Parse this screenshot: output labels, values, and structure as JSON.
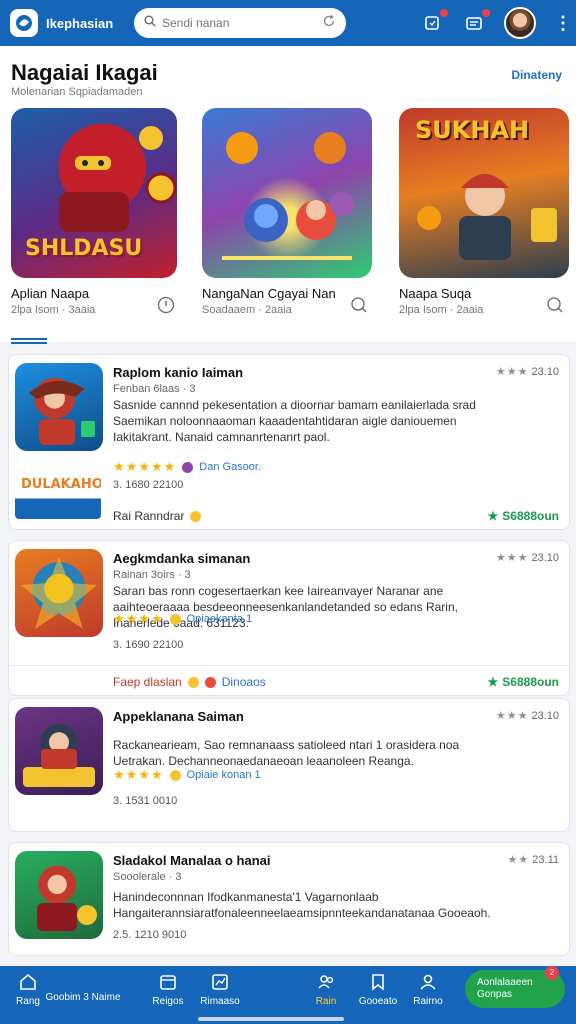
{
  "header": {
    "app_name": "Ikephasian",
    "search": {
      "placeholder": "Sendi nanan",
      "value": ""
    },
    "icons": [
      "logo-icon",
      "search-icon",
      "refresh-icon",
      "notification-icon",
      "inbox-icon",
      "avatar",
      "more-icon"
    ],
    "accent": "#1566b8"
  },
  "section": {
    "title": "Nagaiai Ikagai",
    "subtitle": "Molenarian Sqpiadamaden",
    "link": "Dinateny",
    "featured": [
      {
        "name": "Aplian Naapa",
        "meta": "2lpa Isom · 3aaia",
        "art_text": "SHLDASU",
        "art_colors": [
          "#c21f2a",
          "#1d5fa8",
          "#f4c430"
        ]
      },
      {
        "name": "NangaNan Cgayai Nan",
        "meta": "Soadaaem · 2aaia",
        "art_text": "",
        "art_colors": [
          "#3a7bd5",
          "#8e44ad",
          "#f39c12"
        ]
      },
      {
        "name": "Naapa Suqa",
        "meta": "2lpa Isom · 2aaia",
        "art_text": "SUKHAH",
        "art_colors": [
          "#c0392b",
          "#f39c12",
          "#2c3e50"
        ]
      }
    ]
  },
  "list": [
    {
      "title": "Raplom kanio Iaiman",
      "sub": "Fenban 6laas · 3",
      "desc": "Sasnide cannnd pekesentation a dioornar bamam eanilaierlada srad Saemikan noloonnaaoman kaaadentahtidaran aigle daniouemen Iakitakrant. Nanaid camnanrtenanrt paol.",
      "rating": "★★★★★",
      "tag": "Dan Gasoor.",
      "tag_color": "#8e44ad",
      "stats": "3. 1680 22100",
      "right": "23.10",
      "foot_left": "Rai Ranndrar",
      "foot_right": "S6888oun",
      "badge_text": "DULAKAHO",
      "art_colors": [
        "#1d8fe0",
        "#c0392b",
        "#f4c430"
      ]
    },
    {
      "title": "Aegkmdanka simanan",
      "sub": "Rainan 3oirs · 3",
      "desc": "Saran bas ronn cogesertaerkan kee Iaireanvayer Naranar ane aaihteoeraaaa besdeeonneesenkanlandetanded so edans Rarin, Inanerlede 6aad. 631123.",
      "rating": "★★★★",
      "tag": "Opiaekanta 1",
      "tag_color": "#f4c430",
      "stats": "3. 1690 22100",
      "right": "23.10",
      "foot_left": "Faep dlaslan",
      "foot_mid": "Dinoaos",
      "foot_right": "S6888oun",
      "art_colors": [
        "#e67e22",
        "#2980b9",
        "#f1c40f"
      ]
    },
    {
      "title": "Appeklanana Saiman",
      "sub": "",
      "desc": "Rackanearieam, Sao remnanaass satioleed ntari 1 orasidera noa Uetrakan. Dechanneonaedanaeoan leaanoleen Reanga.",
      "rating": "★★★★",
      "tag": "Opiaie konan 1",
      "tag_color": "#f4c430",
      "stats": "3. 1531 0010",
      "right": "23.10",
      "art_colors": [
        "#6c3483",
        "#c0392b",
        "#f4c430"
      ]
    },
    {
      "title": "Sladakol Manalaa o hanai",
      "sub": "Sooolerale · 3",
      "desc": "Hanindeconnnan Ifodkanmanesta'1 Vagarnonlaab Hangaiterannsiaratfonaleenneelaeamsipnnteekandanatanaa Gooeaoh.",
      "stats": "2.5. 1210 9010",
      "right": "23.11",
      "art_colors": [
        "#27ae60",
        "#c0392b",
        "#f4c430"
      ]
    }
  ],
  "bottom_nav": {
    "items": [
      {
        "label": "Rang",
        "icon": "home-icon",
        "active": false
      },
      {
        "label": "Goobim 3 Naime",
        "icon": "",
        "active": false
      },
      {
        "label": "Reigos",
        "icon": "calendar-icon",
        "active": false
      },
      {
        "label": "Rimaaso",
        "icon": "chart-icon",
        "active": false
      },
      {
        "label": "Rain",
        "icon": "users-icon",
        "active": true
      },
      {
        "label": "Gooeato",
        "icon": "bookmark-icon",
        "active": false
      },
      {
        "label": "Rairno",
        "icon": "profile-icon",
        "active": false
      }
    ],
    "cta_line1": "Aonlalaaeen",
    "cta_line2": "Gonpas",
    "cta_badge": "2",
    "active_color": "#ffcf33",
    "cta_color": "#22a34b"
  }
}
